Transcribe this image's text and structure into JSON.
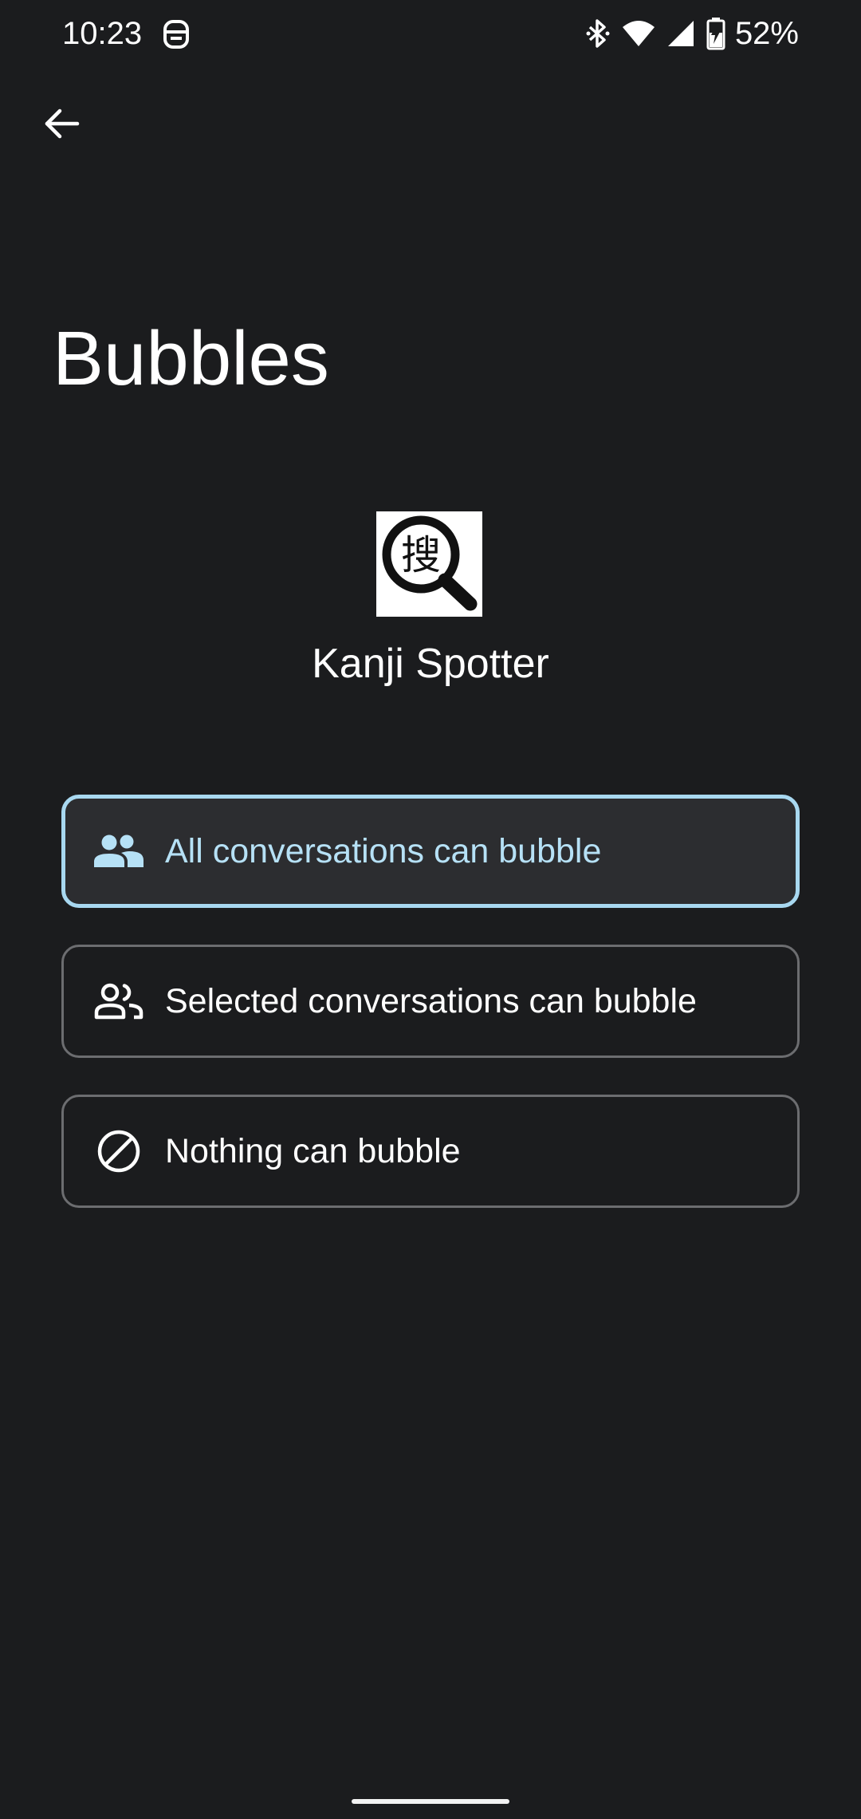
{
  "status_bar": {
    "time": "10:23",
    "battery_percent": "52%",
    "icons": [
      "notification-app-icon",
      "bluetooth-icon",
      "wifi-icon",
      "cellular-signal-icon",
      "battery-charging-icon"
    ]
  },
  "header": {
    "back_icon": "arrow-back-icon",
    "title": "Bubbles"
  },
  "app": {
    "name": "Kanji Spotter",
    "icon_glyph": "搜",
    "icon": "magnifier-kanji-icon"
  },
  "options": [
    {
      "label": "All conversations can bubble",
      "icon": "people-filled-icon",
      "selected": true
    },
    {
      "label": "Selected conversations can bubble",
      "icon": "people-outline-icon",
      "selected": false
    },
    {
      "label": "Nothing can bubble",
      "icon": "block-icon",
      "selected": false
    }
  ],
  "colors": {
    "background": "#1b1c1e",
    "selected_border": "#a8d8f0",
    "selected_text": "#b6e1f6",
    "selected_fill": "#2c2d30",
    "unselected_border": "#6c6d70"
  }
}
